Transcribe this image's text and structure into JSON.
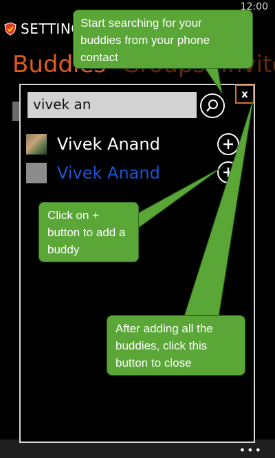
{
  "status": {
    "time": "12:00"
  },
  "header": {
    "title": "SETTING"
  },
  "pivot": {
    "active": "Buddies",
    "next": "Groups",
    "more": "Invites"
  },
  "search": {
    "value": "vivek an"
  },
  "close": {
    "label": "x"
  },
  "results": [
    {
      "name": "Vivek Anand",
      "avatar": "photo"
    },
    {
      "name": "Vivek Anand",
      "avatar": "blank",
      "highlight": true
    }
  ],
  "tips": {
    "search_tip": "Start searching for your buddies from your phone contact",
    "add_tip": "Click on + button to add a buddy",
    "close_tip": "After adding all the buddies, click this button to close"
  },
  "appbar": {
    "more": "•••"
  },
  "colors": {
    "accent": "#e05a1c",
    "tip": "#5aa636",
    "highlight": "#1a54d6"
  },
  "icons": {
    "shield": "shield-icon",
    "search": "search-icon",
    "add": "plus-icon",
    "close": "close-icon"
  }
}
